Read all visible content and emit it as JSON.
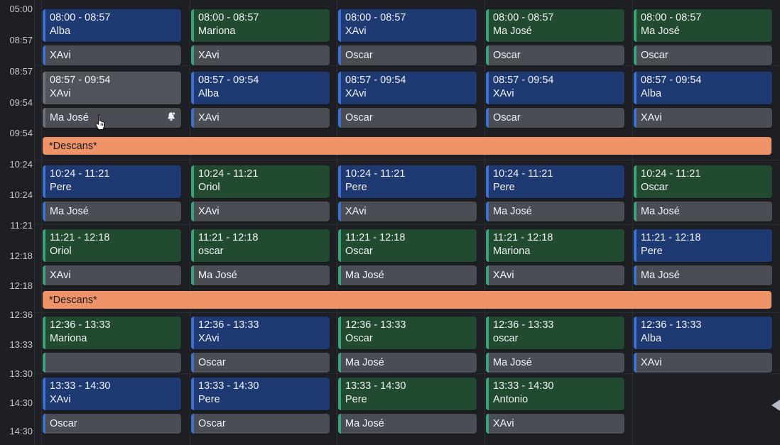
{
  "time_labels": [
    "05:00",
    "08:57",
    "08:57",
    "09:54",
    "09:54",
    "10:24",
    "10:24",
    "11:21",
    "12:18",
    "12:18",
    "12:36",
    "13:33",
    "13:30",
    "14:30",
    "14:30"
  ],
  "rows": [
    {
      "time": "",
      "cells": [
        {
          "time": "08:00 - 08:57",
          "name": "Alba",
          "color": "blue",
          "sub": "XAvi"
        },
        {
          "time": "08:00 - 08:57",
          "name": "Mariona",
          "color": "green",
          "sub": "XAvi"
        },
        {
          "time": "08:00 - 08:57",
          "name": "XAvi",
          "color": "blue",
          "sub": "Oscar"
        },
        {
          "time": "08:00 - 08:57",
          "name": "Ma José",
          "color": "green",
          "sub": "Oscar"
        },
        {
          "time": "08:00 - 08:57",
          "name": "Ma José",
          "color": "green",
          "sub": "Oscar"
        }
      ]
    },
    {
      "cells": [
        {
          "time": "08:57 - 09:54",
          "name": "XAvi",
          "color": "gray",
          "sub": "Ma José",
          "bell": true
        },
        {
          "time": "08:57 - 09:54",
          "name": "Alba",
          "color": "blue",
          "sub": "XAvi"
        },
        {
          "time": "08:57 - 09:54",
          "name": "XAvi",
          "color": "blue",
          "sub": "Oscar"
        },
        {
          "time": "08:57 - 09:54",
          "name": "XAvi",
          "color": "blue",
          "sub": "Oscar"
        },
        {
          "time": "08:57 - 09:54",
          "name": "Alba",
          "color": "blue",
          "sub": "XAvi"
        }
      ]
    },
    {
      "cells": [
        {
          "time": "10:24 - 11:21",
          "name": "Pere",
          "color": "blue",
          "sub": "Ma José"
        },
        {
          "time": "10:24 - 11:21",
          "name": "Oriol",
          "color": "green",
          "sub": "XAvi"
        },
        {
          "time": "10:24 - 11:21",
          "name": "Pere",
          "color": "blue",
          "sub": "XAvi"
        },
        {
          "time": "10:24 - 11:21",
          "name": "Pere",
          "color": "blue",
          "sub": "Ma José"
        },
        {
          "time": "10:24 - 11:21",
          "name": "Oscar",
          "color": "green",
          "sub": "Ma José"
        }
      ]
    },
    {
      "cells": [
        {
          "time": "11:21 - 12:18",
          "name": "Oriol",
          "color": "green",
          "sub": "XAvi"
        },
        {
          "time": "11:21 - 12:18",
          "name": "oscar",
          "color": "green",
          "sub": "Ma José"
        },
        {
          "time": "11:21 - 12:18",
          "name": "Oscar",
          "color": "green",
          "sub": "Ma José"
        },
        {
          "time": "11:21 - 12:18",
          "name": "Mariona",
          "color": "green",
          "sub": "XAvi"
        },
        {
          "time": "11:21 - 12:18",
          "name": "Pere",
          "color": "blue",
          "sub": "Ma José"
        }
      ]
    },
    {
      "cells": [
        {
          "time": "12:36 - 13:33",
          "name": "Mariona",
          "color": "green",
          "sub": ""
        },
        {
          "time": "12:36 - 13:33",
          "name": "XAvi",
          "color": "blue",
          "sub": "Oscar"
        },
        {
          "time": "12:36 - 13:33",
          "name": "Oscar",
          "color": "green",
          "sub": "Ma José"
        },
        {
          "time": "12:36 - 13:33",
          "name": "oscar",
          "color": "green",
          "sub": "Ma José"
        },
        {
          "time": "12:36 - 13:33",
          "name": "Alba",
          "color": "blue",
          "sub": "XAvi"
        }
      ]
    },
    {
      "cells": [
        {
          "time": "13:33 - 14:30",
          "name": "XAvi",
          "color": "blue",
          "sub": "Oscar"
        },
        {
          "time": "13:33 - 14:30",
          "name": "Pere",
          "color": "blue",
          "sub": "Oscar"
        },
        {
          "time": "13:33 - 14:30",
          "name": "Pere",
          "color": "green",
          "sub": "Ma José"
        },
        {
          "time": "13:33 - 14:30",
          "name": "Antonio",
          "color": "green",
          "sub": "XAvi"
        }
      ]
    }
  ],
  "breaks": [
    {
      "label": "*Descans*"
    },
    {
      "label": "*Descans*"
    }
  ],
  "colors": {
    "blue": "#1f3a73",
    "green": "#214a30",
    "break": "#ee9367",
    "background": "#1d1f24"
  },
  "icons": {
    "bell": "bell-icon",
    "cursor": "hand-pointer-icon",
    "edge": "collapse-arrow-icon"
  }
}
